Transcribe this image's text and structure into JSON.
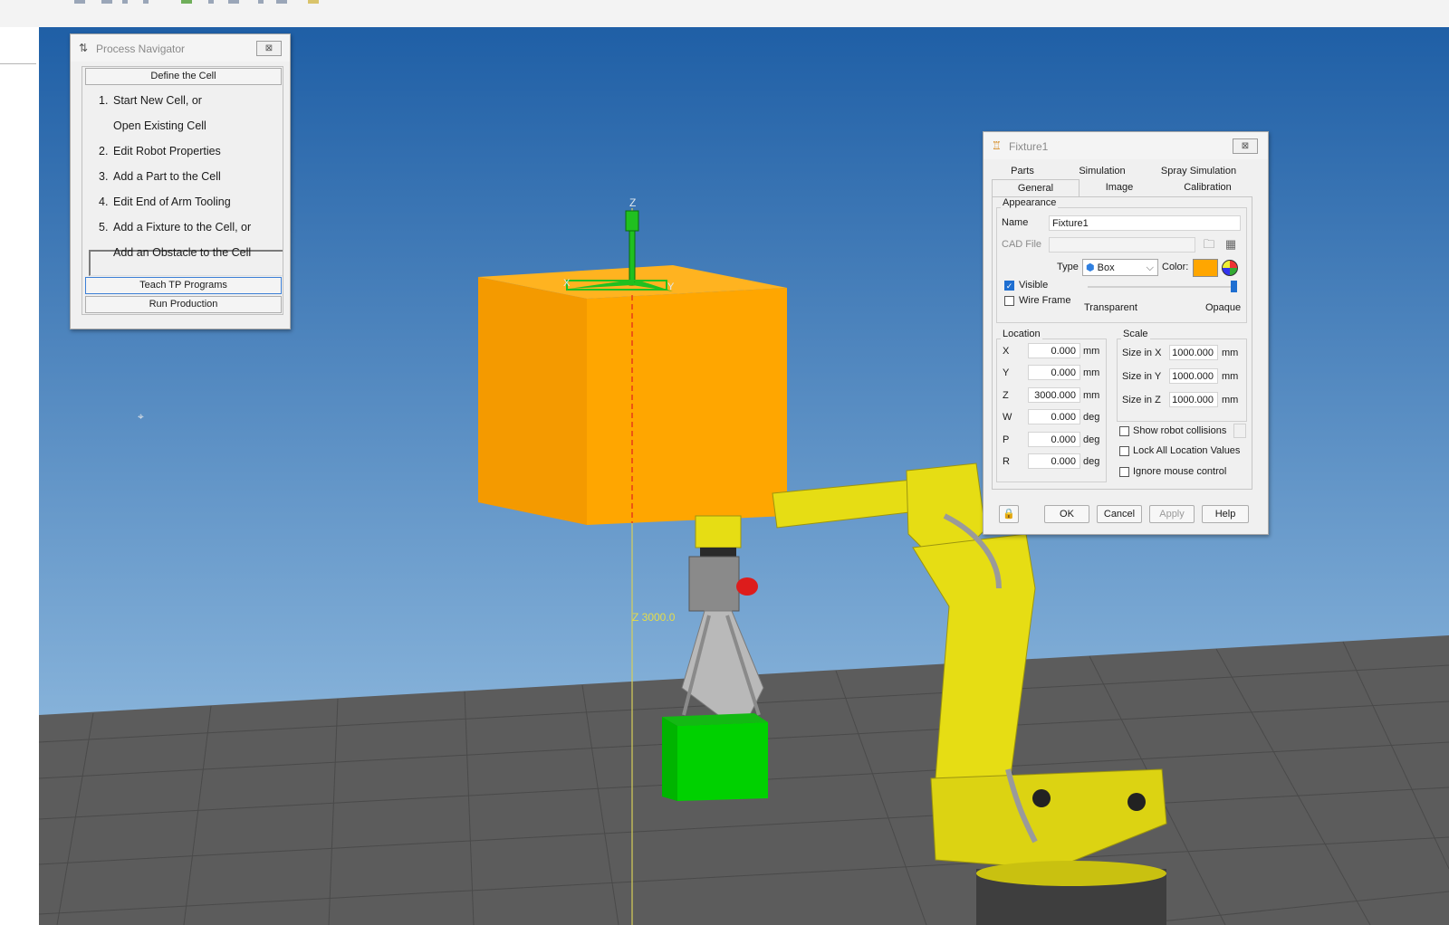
{
  "process_navigator": {
    "title": "Process Navigator",
    "close_glyph": "⊠",
    "title_icon": "process-navigator-icon",
    "define_label": "Define the Cell",
    "steps": [
      {
        "num": "1.",
        "text": "Start New Cell, or"
      },
      {
        "num": "",
        "text": "Open Existing Cell"
      },
      {
        "num": "2.",
        "text": "Edit Robot Properties"
      },
      {
        "num": "3.",
        "text": "Add a Part to the Cell"
      },
      {
        "num": "4.",
        "text": "Edit End of Arm Tooling"
      },
      {
        "num": "5.",
        "text": "Add a Fixture to the Cell, or"
      },
      {
        "num": "",
        "text": "Add an Obstacle to the Cell"
      }
    ],
    "teach_label": "Teach TP Programs",
    "run_label": "Run Production"
  },
  "scene": {
    "axis_labels": {
      "z": "Z",
      "x": "X",
      "y": "Y"
    },
    "z_readout": "Z 3000.0",
    "colors": {
      "sky_top": "#1f5fa6",
      "sky_bottom": "#8bb6dc",
      "floor": "#5c5c5c",
      "fixture_front": "#ffa600",
      "fixture_side": "#f49a00",
      "part": "#00d100",
      "robot": "#e6dd14"
    }
  },
  "fixture_dialog": {
    "title": "Fixture1",
    "title_icon": "fixture-icon",
    "close_glyph": "⊠",
    "tabs_row1": [
      "Parts",
      "Simulation",
      "Spray Simulation"
    ],
    "tabs_row2": [
      "General",
      "Image",
      "Calibration"
    ],
    "active_tab": "General",
    "appearance": {
      "group_label": "Appearance",
      "name_label": "Name",
      "name_value": "Fixture1",
      "cad_label": "CAD File",
      "cad_value": "",
      "type_label": "Type",
      "type_value": "Box",
      "color_label": "Color:",
      "color_value": "#ffa600",
      "visible_label": "Visible",
      "visible_checked": true,
      "wireframe_label": "Wire Frame",
      "wireframe_checked": false,
      "transparent_label": "Transparent",
      "opaque_label": "Opaque",
      "opacity": 1.0
    },
    "location": {
      "group_label": "Location",
      "rows": [
        {
          "axis": "X",
          "value": "0.000",
          "unit": "mm"
        },
        {
          "axis": "Y",
          "value": "0.000",
          "unit": "mm"
        },
        {
          "axis": "Z",
          "value": "3000.000",
          "unit": "mm"
        },
        {
          "axis": "W",
          "value": "0.000",
          "unit": "deg"
        },
        {
          "axis": "P",
          "value": "0.000",
          "unit": "deg"
        },
        {
          "axis": "R",
          "value": "0.000",
          "unit": "deg"
        }
      ]
    },
    "scale": {
      "group_label": "Scale",
      "rows": [
        {
          "label": "Size in X",
          "value": "1000.000",
          "unit": "mm"
        },
        {
          "label": "Size in Y",
          "value": "1000.000",
          "unit": "mm"
        },
        {
          "label": "Size in Z",
          "value": "1000.000",
          "unit": "mm"
        }
      ]
    },
    "options": [
      {
        "label": "Show robot collisions",
        "checked": false
      },
      {
        "label": "Lock All Location Values",
        "checked": false
      },
      {
        "label": "Ignore mouse control",
        "checked": false
      }
    ],
    "buttons": {
      "ok": "OK",
      "cancel": "Cancel",
      "apply": "Apply",
      "help": "Help"
    }
  }
}
